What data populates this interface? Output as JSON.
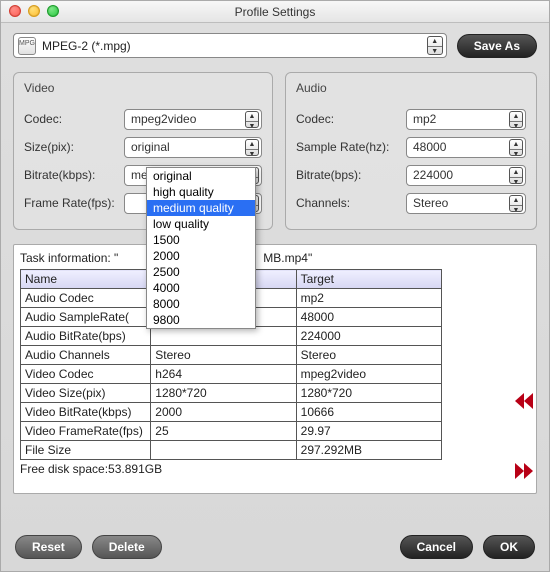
{
  "window": {
    "title": "Profile Settings"
  },
  "profile": {
    "format_label": "MPEG-2 (*.mpg)",
    "save_as_label": "Save As"
  },
  "video_panel": {
    "title": "Video",
    "codec_label": "Codec:",
    "codec_value": "mpeg2video",
    "size_label": "Size(pix):",
    "size_value": "original",
    "bitrate_label": "Bitrate(kbps):",
    "bitrate_value": "medium quality",
    "framerate_label": "Frame Rate(fps):",
    "framerate_value": ""
  },
  "bitrate_dropdown": {
    "options": [
      "original",
      "high quality",
      "medium quality",
      "low quality",
      "1500",
      "2000",
      "2500",
      "4000",
      "8000",
      "9800"
    ],
    "selected": "medium quality"
  },
  "audio_panel": {
    "title": "Audio",
    "codec_label": "Codec:",
    "codec_value": "mp2",
    "samplerate_label": "Sample Rate(hz):",
    "samplerate_value": "48000",
    "bitrate_label": "Bitrate(bps):",
    "bitrate_value": "224000",
    "channels_label": "Channels:",
    "channels_value": "Stereo"
  },
  "task": {
    "info_prefix": "Task information: \"",
    "info_suffix_visible": "MB.mp4\"",
    "header_name": "Name",
    "header_target": "Target",
    "rows": [
      {
        "name": "Audio Codec",
        "src": "",
        "tgt": "mp2"
      },
      {
        "name": "Audio SampleRate(",
        "src": "",
        "tgt": "48000"
      },
      {
        "name": "Audio BitRate(bps)",
        "src": "",
        "tgt": "224000"
      },
      {
        "name": "Audio Channels",
        "src": "Stereo",
        "tgt": "Stereo"
      },
      {
        "name": "Video Codec",
        "src": "h264",
        "tgt": "mpeg2video"
      },
      {
        "name": "Video Size(pix)",
        "src": "1280*720",
        "tgt": "1280*720"
      },
      {
        "name": "Video BitRate(kbps)",
        "src": "2000",
        "tgt": "10666"
      },
      {
        "name": "Video FrameRate(fps)",
        "src": "25",
        "tgt": "29.97"
      },
      {
        "name": "File Size",
        "src": "",
        "tgt": "297.292MB"
      }
    ],
    "free_disk": "Free disk space:53.891GB"
  },
  "buttons": {
    "reset": "Reset",
    "delete": "Delete",
    "cancel": "Cancel",
    "ok": "OK"
  }
}
